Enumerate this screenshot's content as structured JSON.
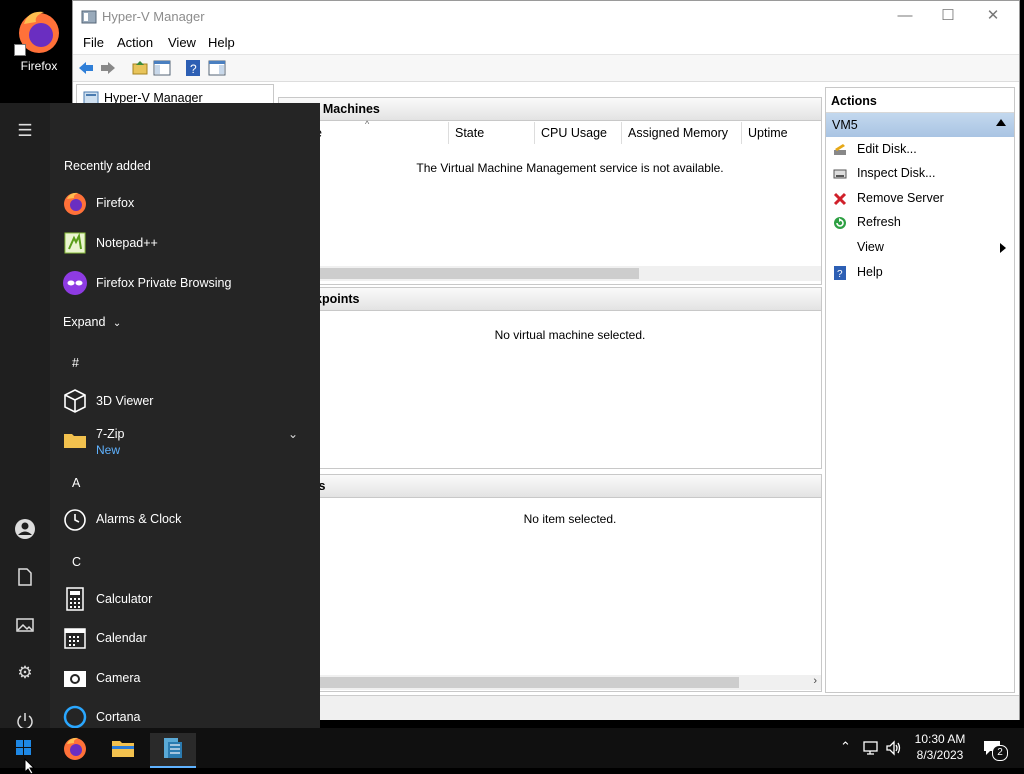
{
  "desktop": {
    "firefox_label": "Firefox"
  },
  "window": {
    "title": "Hyper-V Manager",
    "menu": [
      "File",
      "Action",
      "View",
      "Help"
    ],
    "tree_root": "Hyper-V Manager",
    "vm_pane": {
      "title": "Virtual Machines",
      "title_visible": "al Machines",
      "columns": [
        "e",
        "State",
        "CPU Usage",
        "Assigned Memory",
        "Uptime"
      ],
      "message": "The Virtual Machine Management service is not available."
    },
    "checkpoints_pane": {
      "title_visible": "kpoints",
      "message": "No virtual machine selected."
    },
    "details_pane": {
      "title_visible": "ls",
      "message": "No item selected."
    },
    "actions": {
      "header": "Actions",
      "section": "VM5",
      "items": [
        {
          "label": "Edit Disk...",
          "icon": "edit-disk-icon"
        },
        {
          "label": "Inspect Disk...",
          "icon": "inspect-disk-icon"
        },
        {
          "label": "Remove Server",
          "icon": "remove-icon"
        },
        {
          "label": "Refresh",
          "icon": "refresh-icon"
        },
        {
          "label": "View",
          "icon": "submenu-arrow-icon"
        },
        {
          "label": "Help",
          "icon": "help-icon"
        }
      ]
    }
  },
  "start_menu": {
    "recently_added_label": "Recently added",
    "recent": [
      "Firefox",
      "Notepad++",
      "Firefox Private Browsing"
    ],
    "expand_label": "Expand",
    "letters": [
      "#",
      "A",
      "C"
    ],
    "apps": {
      "viewer3d": "3D Viewer",
      "zip": "7-Zip",
      "zip_badge": "New",
      "alarms": "Alarms & Clock",
      "calculator": "Calculator",
      "calendar": "Calendar",
      "camera": "Camera",
      "cortana": "Cortana"
    }
  },
  "taskbar": {
    "time": "10:30 AM",
    "date": "8/3/2023",
    "notification_count": "2"
  },
  "colors": {
    "accent": "#1e88e5",
    "vm_header": "#b7cfe9",
    "start_bg": "#252525"
  }
}
